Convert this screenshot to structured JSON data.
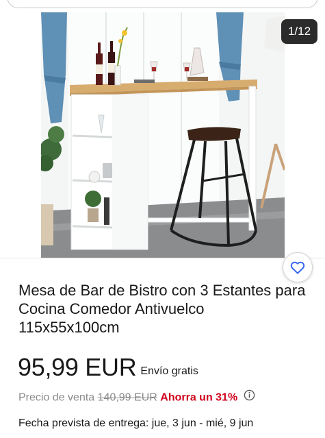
{
  "gallery": {
    "counter": "1/12"
  },
  "product": {
    "title": "Mesa de Bar de Bistro con 3 Estantes para Cocina Comedor Antivuelco 115x55x100cm",
    "price": "95,99 EUR",
    "shipping": "Envío gratis",
    "original_price_label": "Precio de venta",
    "original_price": "140,99 EUR",
    "discount": "Ahorra un 31%",
    "delivery": "Fecha prevista de entrega: jue, 3 jun - mié, 9 jun"
  },
  "colors": {
    "discount": "#d0021b",
    "accent": "#3665f3",
    "counter_bg": "#2b2b2b"
  },
  "icons": {
    "favorite": "heart-icon",
    "info": "info-icon"
  }
}
